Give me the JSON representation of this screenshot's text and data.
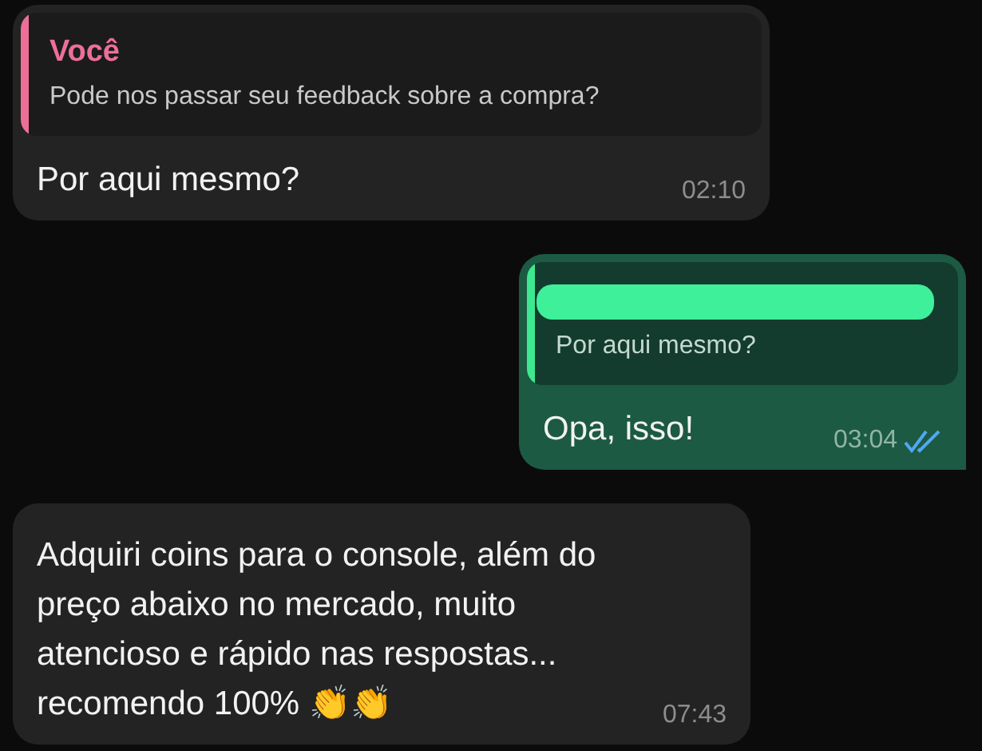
{
  "messages": [
    {
      "kind": "incoming",
      "quote": {
        "author": "Você",
        "text": "Pode nos passar seu feedback sobre a compra?"
      },
      "text": "Por aqui mesmo?",
      "time": "02:10"
    },
    {
      "kind": "outgoing",
      "quote": {
        "text": "Por aqui mesmo?",
        "redacted_author": true
      },
      "text": "Opa, isso!",
      "time": "03:04",
      "read": true
    },
    {
      "kind": "incoming",
      "text": "Adquiri coins para o console, além do preço abaixo no mercado, muito atencioso e rápido nas respostas... recomendo 100% 👏👏",
      "time": "07:43"
    }
  ]
}
